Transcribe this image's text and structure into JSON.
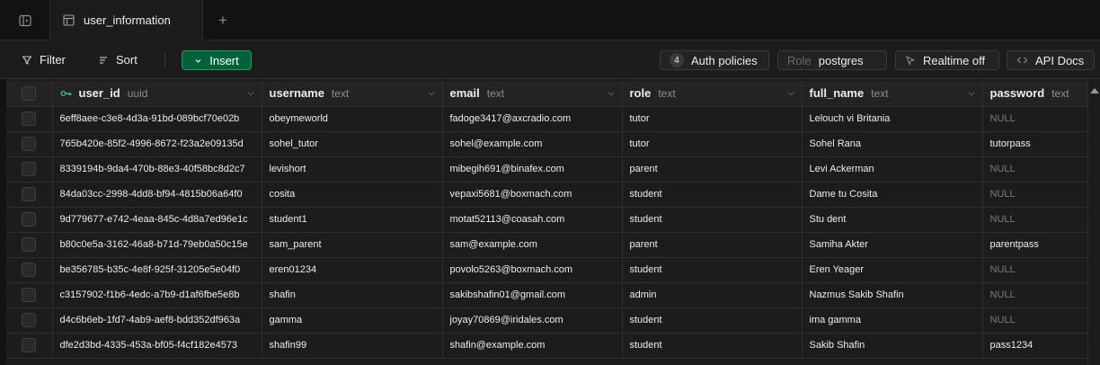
{
  "tabs": {
    "items": [
      {
        "label": "user_information",
        "active": true
      }
    ],
    "add_symbol": "+"
  },
  "toolbar": {
    "filter_label": "Filter",
    "sort_label": "Sort",
    "insert_label": "Insert",
    "auth_count": "4",
    "auth_label": "Auth policies",
    "role_prefix": "Role",
    "role_value": "postgres",
    "realtime_label": "Realtime off",
    "api_docs_label": "API Docs"
  },
  "table": {
    "columns": [
      {
        "name": "user_id",
        "type": "uuid",
        "primary_key": true
      },
      {
        "name": "username",
        "type": "text"
      },
      {
        "name": "email",
        "type": "text"
      },
      {
        "name": "role",
        "type": "text"
      },
      {
        "name": "full_name",
        "type": "text"
      },
      {
        "name": "password",
        "type": "text"
      }
    ],
    "rows": [
      [
        "6eff8aee-c3e8-4d3a-91bd-089bcf70e02b",
        "obeymeworld",
        "fadoge3417@axcradio.com",
        "tutor",
        "Lelouch vi Britania",
        "NULL"
      ],
      [
        "765b420e-85f2-4996-8672-f23a2e09135d",
        "sohel_tutor",
        "sohel@example.com",
        "tutor",
        "Sohel Rana",
        "tutorpass"
      ],
      [
        "8339194b-9da4-470b-88e3-40f58bc8d2c7",
        "levishort",
        "mibegih691@binafex.com",
        "parent",
        "Levi Ackerman",
        "NULL"
      ],
      [
        "84da03cc-2998-4dd8-bf94-4815b06a64f0",
        "cosita",
        "vepaxi5681@boxmach.com",
        "student",
        "Dame tu Cosita",
        "NULL"
      ],
      [
        "9d779677-e742-4eaa-845c-4d8a7ed96e1c",
        "student1",
        "motat52113@coasah.com",
        "student",
        "Stu dent",
        "NULL"
      ],
      [
        "b80c0e5a-3162-46a8-b71d-79eb0a50c15e",
        "sam_parent",
        "sam@example.com",
        "parent",
        "Samiha Akter",
        "parentpass"
      ],
      [
        "be356785-b35c-4e8f-925f-31205e5e04f0",
        "eren01234",
        "povolo5263@boxmach.com",
        "student",
        "Eren Yeager",
        "NULL"
      ],
      [
        "c3157902-f1b6-4edc-a7b9-d1af6fbe5e8b",
        "shafin",
        "sakibshafin01@gmail.com",
        "admin",
        "Nazmus Sakib Shafin",
        "NULL"
      ],
      [
        "d4c6b6eb-1fd7-4ab9-aef8-bdd352df963a",
        "gamma",
        "joyay70869@iridales.com",
        "student",
        "ima gamma",
        "NULL"
      ],
      [
        "dfe2d3bd-4335-453a-bf05-f4cf182e4573",
        "shafin99",
        "shafin@example.com",
        "student",
        "Sakib Shafin",
        "pass1234"
      ]
    ]
  },
  "colors": {
    "background": "#1c1c1c",
    "accent": "#3ecf8e",
    "insert_bg": "#006239",
    "null_text": "#7a7a7a"
  },
  "icons": [
    "sidebar-toggle-icon",
    "table-icon",
    "plus-icon",
    "filter-icon",
    "sort-icon",
    "chevron-down-icon",
    "key-icon",
    "lock-icon",
    "broadcast-icon",
    "code-icon",
    "scroll-up-icon"
  ]
}
